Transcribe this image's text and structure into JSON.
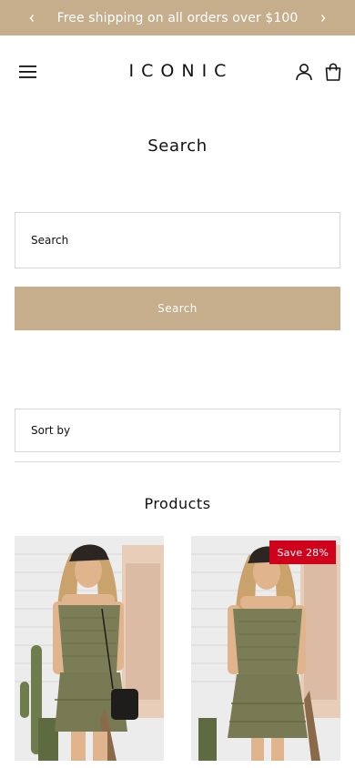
{
  "announcement": {
    "text": "Free shipping on all orders over $100",
    "prev_icon": "chevron-left-icon",
    "next_icon": "chevron-right-icon"
  },
  "header": {
    "logo": "ICONIC",
    "menu_icon": "hamburger-menu-icon",
    "account_icon": "user-icon",
    "cart_icon": "shopping-bag-icon"
  },
  "page": {
    "title": "Search"
  },
  "search": {
    "placeholder": "Search",
    "button_label": "Search"
  },
  "sort": {
    "label": "Sort by"
  },
  "products_section": {
    "title": "Products",
    "items": [
      {
        "image": "woman in olive off-shoulder ruffle top and skirt, black cap, standing near cactus"
      },
      {
        "image": "woman in olive off-shoulder ruffle top and skirt, black cap, standing near cactus",
        "badge": "Save 28%"
      }
    ]
  },
  "colors": {
    "accent": "#c6ad8b",
    "sale": "#d0021b",
    "border": "#d6d6d6"
  }
}
